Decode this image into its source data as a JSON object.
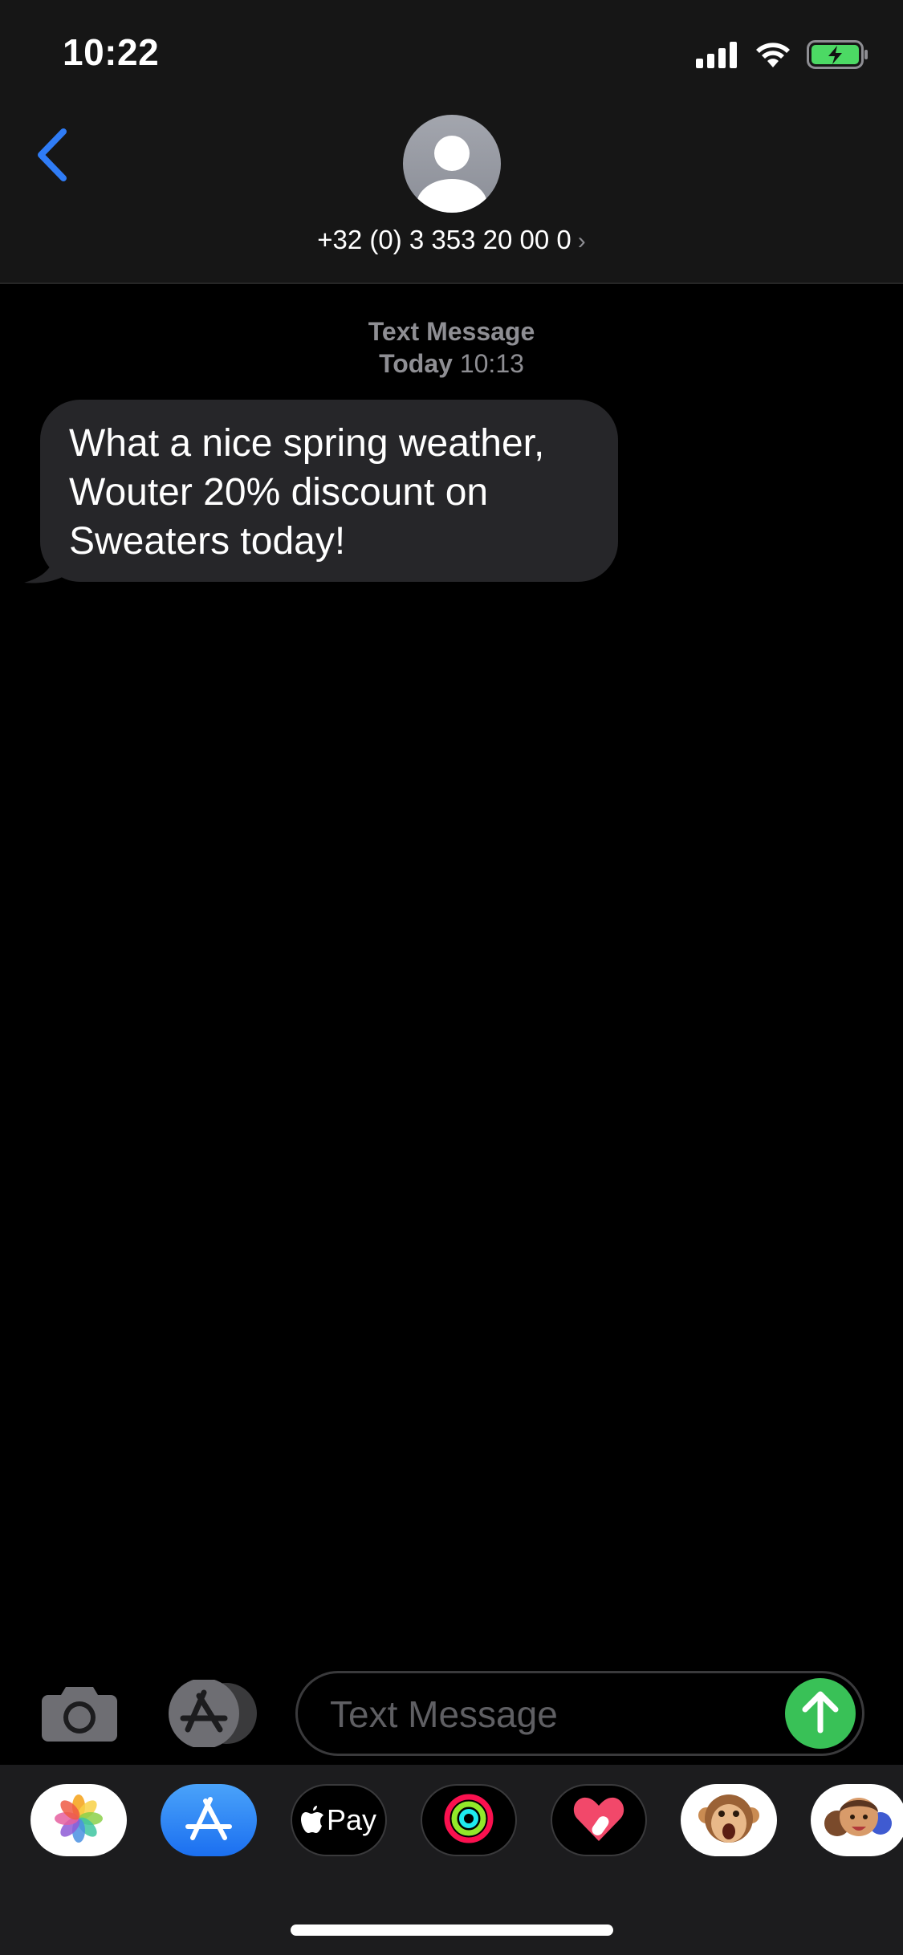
{
  "status_bar": {
    "time": "10:22",
    "icons": [
      "cellular-signal-icon",
      "wifi-icon",
      "battery-charging-icon"
    ]
  },
  "header": {
    "back_icon": "chevron-left-icon",
    "avatar_icon": "person-icon",
    "contact": "+32 (0) 3 353 20 00 0",
    "contact_chevron": "›"
  },
  "conversation": {
    "meta_line1": "Text Message",
    "meta_day": "Today",
    "meta_time": "10:13",
    "messages": [
      {
        "direction": "incoming",
        "text": "What a nice spring weather, Wouter 20% discount on Sweaters today!"
      }
    ]
  },
  "compose": {
    "camera_icon": "camera-icon",
    "apps_icon": "app-store-icon",
    "placeholder": "Text Message",
    "value": "",
    "send_icon": "arrow-up-icon"
  },
  "app_drawer": {
    "apps": [
      {
        "name": "photos-app-icon"
      },
      {
        "name": "app-store-app-icon"
      },
      {
        "name": "apple-pay-app-icon",
        "label": "Pay"
      },
      {
        "name": "activity-app-icon"
      },
      {
        "name": "digital-touch-app-icon"
      },
      {
        "name": "animoji-app-icon"
      },
      {
        "name": "memoji-app-icon"
      }
    ]
  },
  "colors": {
    "accent_blue": "#2f7cf6",
    "send_green": "#39c157",
    "bubble_gray": "#262629",
    "header_bg": "#161616"
  }
}
